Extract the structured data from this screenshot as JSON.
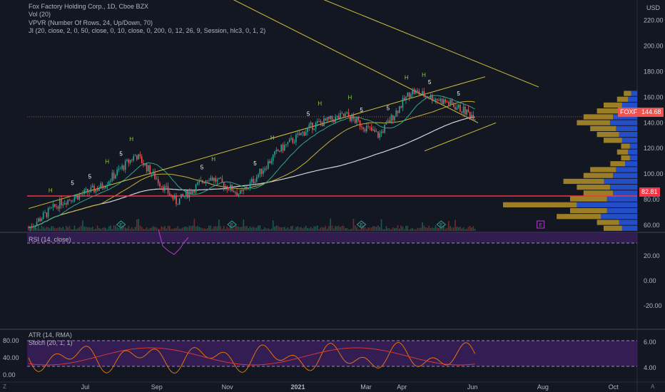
{
  "header": {
    "symbol_line": "Fox Factory Holding Corp., 1D, Cboe BZX",
    "indicators": [
      "Vol (20)",
      "VPVR (Number Of Rows, 24, Up/Down, 70)",
      "JI (20, close, 2, 0, 50, close, 0, 10, close, 0, 200, 0, 12, 26, 9, Session, hlc3, 0, 1, 2)"
    ],
    "currency": "USD"
  },
  "panes": {
    "rsi_label": "RSI (14, close)",
    "atr_label": "ATR (14, RMA)",
    "stoch_label": "Stoch (20, 1, 1)"
  },
  "badges": {
    "symbol": "FOXF",
    "last_price": "144.68",
    "level_price": "82.81"
  },
  "colors": {
    "background": "#131722",
    "up_candle": "#26a69a",
    "down_candle": "#ef5350",
    "channel": "#d4c13a",
    "support_line": "#f23645",
    "vpvr_up": "#2962ff",
    "vpvr_down": "#c9a227",
    "rsi_band": "#7e57c2",
    "stoch_band": "#7e57c2"
  },
  "bottom_icons": {
    "left": "Z",
    "right": "A"
  },
  "chart_data": [
    {
      "type": "candlestick",
      "title": "Fox Factory Holding Corp., 1D, Cboe BZX",
      "y_axis": {
        "ticks": [
          "220.00",
          "200.00",
          "180.00",
          "160.00",
          "140.00",
          "120.00",
          "100.00",
          "80.00",
          "60.00"
        ],
        "ylim": [
          50,
          225
        ]
      },
      "x_axis": {
        "ticks": [
          "Jul",
          "Sep",
          "Nov",
          "2021",
          "Mar",
          "Apr",
          "Jun",
          "Aug",
          "Oct"
        ]
      },
      "trend": {
        "dates": [
          "2020-05-13",
          "2020-06-10",
          "2020-07-15",
          "2020-08-14",
          "2020-09-18",
          "2020-10-16",
          "2020-11-13",
          "2020-12-15",
          "2021-01-14",
          "2021-02-12",
          "2021-03-12",
          "2021-04-09",
          "2021-05-10",
          "2021-06-04"
        ],
        "close": [
          58,
          78,
          90,
          115,
          78,
          98,
          84,
          118,
          138,
          146,
          130,
          165,
          156,
          144.68
        ]
      },
      "horizontal_level": 82.81,
      "markers": [
        "H",
        "5",
        "E"
      ],
      "vpvr_rows": 24
    },
    {
      "type": "line",
      "title": "RSI (14, close)",
      "y_axis": {
        "ticks": [
          "20.00",
          "0.00",
          "-20.00"
        ]
      }
    },
    {
      "type": "line",
      "title": "ATR (14, RMA) / Stoch (20, 1, 1)",
      "y_axis_left": {
        "ticks": [
          "80.00",
          "40.00",
          "0.00"
        ]
      },
      "y_axis_right": {
        "ticks": [
          "6.00",
          "4.00"
        ]
      }
    }
  ]
}
